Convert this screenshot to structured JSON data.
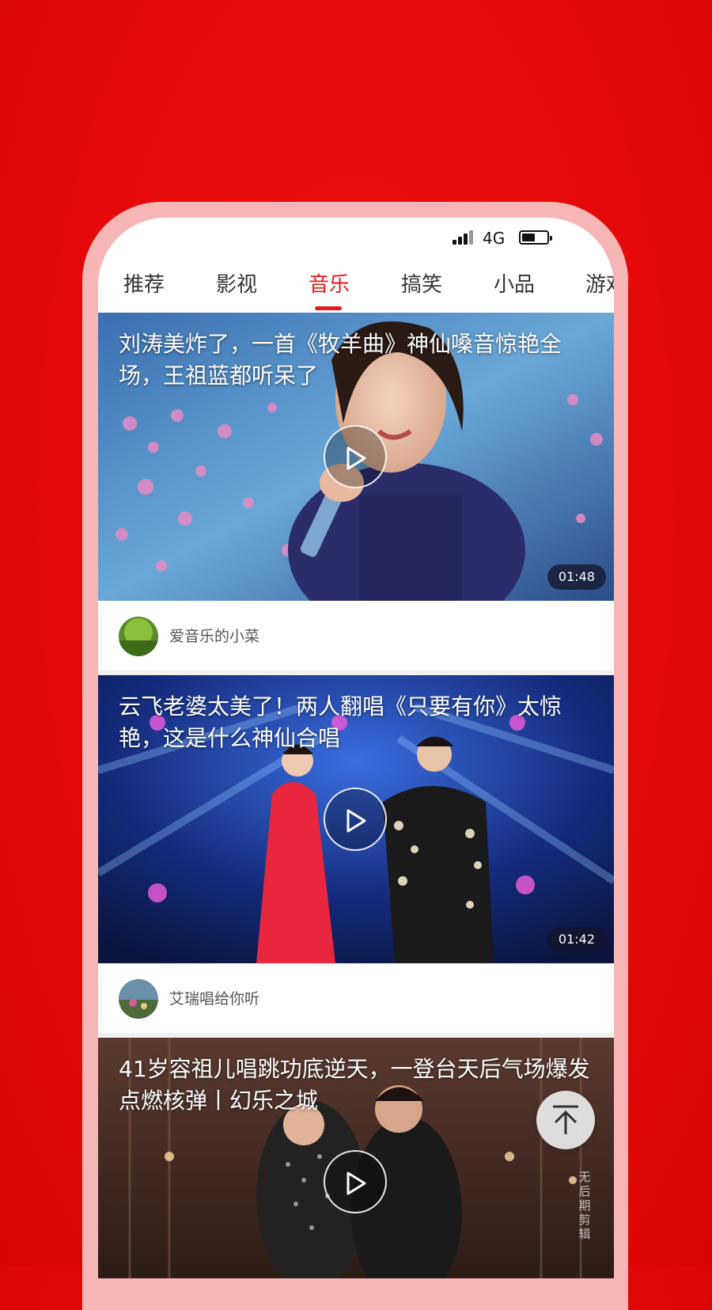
{
  "status_bar": {
    "network": "4G"
  },
  "tabs": [
    {
      "label": "推荐",
      "active": false
    },
    {
      "label": "影视",
      "active": false
    },
    {
      "label": "音乐",
      "active": true
    },
    {
      "label": "搞笑",
      "active": false
    },
    {
      "label": "小品",
      "active": false
    },
    {
      "label": "游戏",
      "active": false
    }
  ],
  "videos": [
    {
      "title": "刘涛美炸了，一首《牧羊曲》神仙嗓音惊艳全场，王祖蓝都听呆了",
      "duration": "01:48",
      "author": "爱音乐的小菜"
    },
    {
      "title": "云飞老婆太美了！两人翻唱《只要有你》太惊艳，这是什么神仙合唱",
      "duration": "01:42",
      "author": "艾瑞唱给你听"
    },
    {
      "title": "41岁容祖儿唱跳功底逆天，一登台天后气场爆发点燃核弹丨幻乐之城"
    }
  ],
  "watermark": "无后期剪辑",
  "colors": {
    "background": "#e60909",
    "accent": "#e11b1b",
    "frame": "#f7b6b6"
  }
}
